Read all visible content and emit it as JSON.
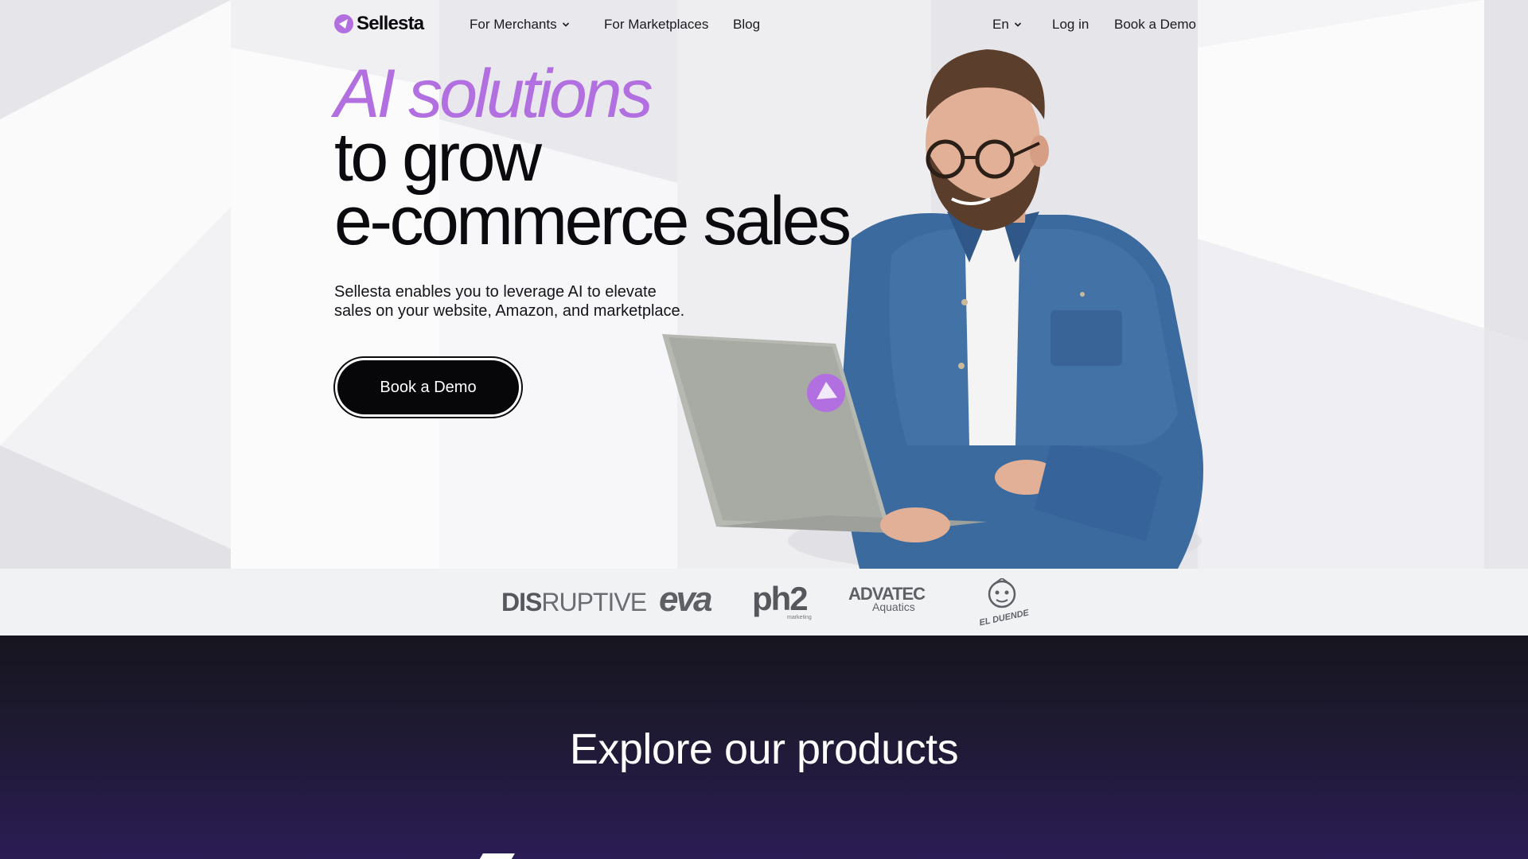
{
  "nav": {
    "brand": "Sellesta",
    "for_merchants": "For Merchants",
    "for_marketplaces": "For Marketplaces",
    "blog": "Blog",
    "language": "En",
    "login": "Log in",
    "book_demo": "Book a Demo"
  },
  "hero": {
    "headline_accent": "AI solutions",
    "headline_line2": "to grow",
    "headline_line3": "e-commerce sales",
    "subtitle_line1": "Sellesta enables you to leverage AI to elevate",
    "subtitle_line2": "sales on your website, Amazon, and marketplace.",
    "cta": "Book a Demo"
  },
  "clients": {
    "disruptive_bold": "DIS",
    "disruptive_rest": "RUPTIVE",
    "eva": "eva",
    "ph2": "ph2",
    "ph2_sub": "marketing",
    "advatec": "ADVATEC",
    "advatec_sub": "Aquatics",
    "elduende": "EL DUENDE"
  },
  "products": {
    "title": "Explore our products"
  },
  "colors": {
    "accent": "#b26fe0",
    "dark": "#0b0b0f",
    "products_bg": "#2b1c55"
  }
}
